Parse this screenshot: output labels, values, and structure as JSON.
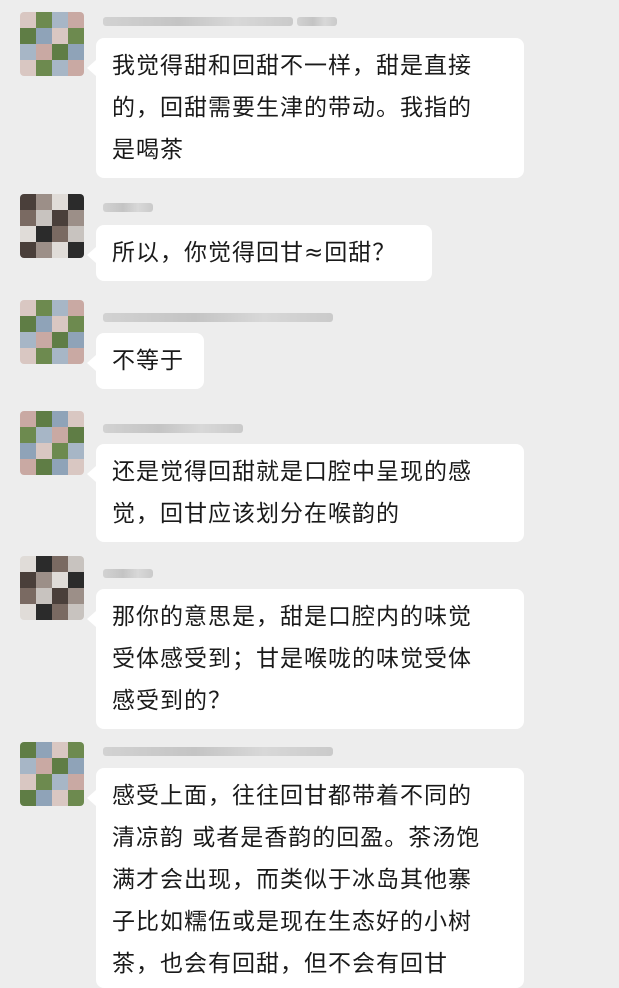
{
  "chat": {
    "messages": [
      {
        "sender": "a",
        "text": "我觉得甜和回甜不一样，甜是直接\n的，回甜需要生津的带动。我指的\n是喝茶"
      },
      {
        "sender": "b",
        "text": "所以，你觉得回甘≈回甜？"
      },
      {
        "sender": "a",
        "text": "不等于"
      },
      {
        "sender": "a",
        "text": "还是觉得回甜就是口腔中呈现的感\n觉，回甘应该划分在喉韵的"
      },
      {
        "sender": "b",
        "text": "那你的意思是，甜是口腔内的味觉\n受体感受到；甘是喉咙的味觉受体\n感受到的？"
      },
      {
        "sender": "a",
        "text": "感受上面，往往回甘都带着不同的\n清凉韵 或者是香韵的回盈。茶汤饱\n满才会出现，而类似于冰岛其他寨\n子比如糯伍或是现在生态好的小树\n茶，也会有回甜，但不会有回甘"
      }
    ]
  },
  "colors": {
    "background": "#ededed",
    "bubble": "#ffffff",
    "text": "#1a1a1a",
    "avatar_a": [
      "#8fa3b8",
      "#d9c7c2",
      "#6d8a4f",
      "#a7b6c6",
      "#c9a9a3",
      "#5f7d45"
    ],
    "avatar_b": [
      "#2b2b2b",
      "#7a6a62",
      "#c8c3bf",
      "#4a3f3a",
      "#9c8f88",
      "#e0dcd8"
    ]
  }
}
